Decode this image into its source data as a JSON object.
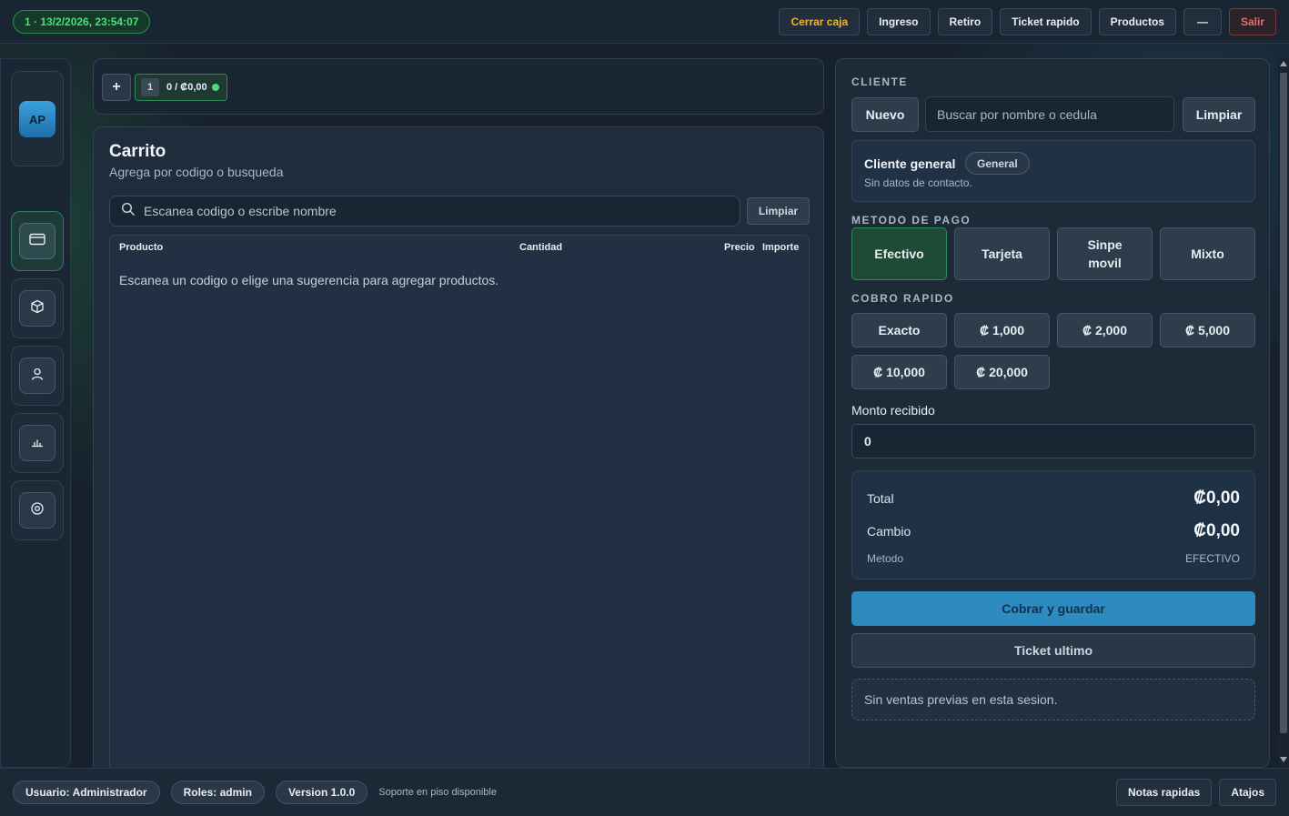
{
  "topbar": {
    "session": "1 · 13/2/2026, 23:54:07",
    "actions": [
      "Cerrar caja",
      "Ingreso",
      "Retiro",
      "Ticket rapido",
      "Productos",
      "—",
      "Salir"
    ]
  },
  "sidebar": {
    "avatar": "AP",
    "items": [
      {
        "icon": "credit-card-icon",
        "active": true
      },
      {
        "icon": "box-icon",
        "active": false
      },
      {
        "icon": "user-icon",
        "active": false
      },
      {
        "icon": "bar-chart-icon",
        "active": false
      },
      {
        "icon": "settings-icon",
        "active": false
      }
    ]
  },
  "tabs": {
    "add_label": "+",
    "cart_tabs": [
      {
        "number": "1",
        "total": "0 / ₡0,00"
      }
    ]
  },
  "cart": {
    "title": "Carrito",
    "subtitle": "Agrega por codigo o busqueda",
    "search_placeholder": "Escanea codigo o escribe nombre",
    "clear_label": "Limpiar",
    "columns": {
      "product": "Producto",
      "quantity": "Cantidad",
      "price": "Precio",
      "amount": "Importe"
    },
    "empty_message": "Escanea un codigo o elige una sugerencia para agregar productos."
  },
  "client": {
    "section_label": "CLIENTE",
    "new_label": "Nuevo",
    "search_placeholder": "Buscar por nombre o cedula",
    "clear_label": "Limpiar",
    "name": "Cliente general",
    "badge": "General",
    "contact": "Sin datos de contacto."
  },
  "payment": {
    "section_label": "METODO DE PAGO",
    "methods": [
      "Efectivo",
      "Tarjeta",
      "Sinpe movil",
      "Mixto"
    ],
    "selected": "Efectivo"
  },
  "quick": {
    "section_label": "COBRO RAPIDO",
    "amounts": [
      "Exacto",
      "₡ 1,000",
      "₡ 2,000",
      "₡ 5,000",
      "₡ 10,000",
      "₡ 20,000"
    ]
  },
  "received": {
    "label": "Monto recibido",
    "value": "0"
  },
  "summary": {
    "total_label": "Total",
    "total_value": "₡0,00",
    "change_label": "Cambio",
    "change_value": "₡0,00",
    "method_label": "Metodo",
    "method_value": "EFECTIVO"
  },
  "actions": {
    "charge": "Cobrar y guardar",
    "last_ticket": "Ticket ultimo",
    "no_sales": "Sin ventas previas en esta sesion."
  },
  "footer": {
    "user": "Usuario: Administrador",
    "roles": "Roles: admin",
    "version": "Version 1.0.0",
    "support": "Soporte en piso disponible",
    "notes": "Notas rapidas",
    "shortcuts": "Atajos"
  }
}
